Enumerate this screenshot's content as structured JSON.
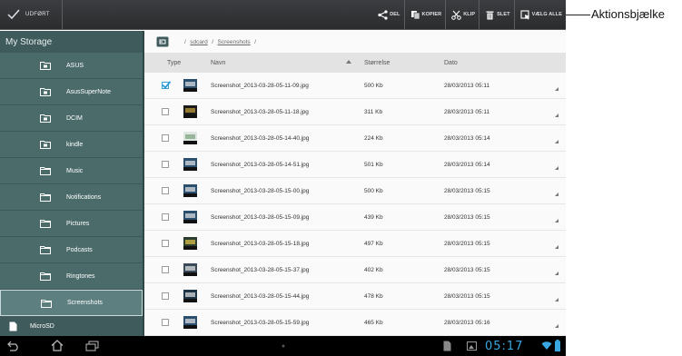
{
  "actionbar": {
    "done_label": "UDFØRT",
    "actions": [
      {
        "label": "DEL",
        "icon": "share-icon"
      },
      {
        "label": "KOPIER",
        "icon": "copy-icon"
      },
      {
        "label": "KLIP",
        "icon": "scissors-icon"
      },
      {
        "label": "SLET",
        "icon": "trash-icon"
      },
      {
        "label": "VÆLG ALLE",
        "icon": "select-all-icon"
      }
    ]
  },
  "callout": {
    "text": "Aktionsbjælke"
  },
  "sidebar": {
    "header": "My Storage",
    "folders": [
      {
        "label": "ASUS",
        "icon": "folder-sync-icon"
      },
      {
        "label": "AsusSuperNote",
        "icon": "folder-sync-icon"
      },
      {
        "label": "DCIM",
        "icon": "folder-sync-icon"
      },
      {
        "label": "kindle",
        "icon": "folder-sync-icon"
      },
      {
        "label": "Music",
        "icon": "folder-icon"
      },
      {
        "label": "Notifications",
        "icon": "folder-icon"
      },
      {
        "label": "Pictures",
        "icon": "folder-icon"
      },
      {
        "label": "Podcasts",
        "icon": "folder-icon"
      },
      {
        "label": "Ringtones",
        "icon": "folder-icon"
      },
      {
        "label": "Screenshots",
        "icon": "folder-icon",
        "selected": true
      }
    ],
    "microsd": "MicroSD"
  },
  "breadcrumb": {
    "sep1": "/",
    "part1": "sdcard",
    "sep2": "/",
    "part2": "Screenshots",
    "sep3": "/"
  },
  "columns": {
    "type": "Type",
    "name": "Navn",
    "size": "Størrelse",
    "date": "Dato"
  },
  "files": [
    {
      "name": "Screenshot_2013-03-28-05-11-09.jpg",
      "size": "500 Kb",
      "date": "28/03/2013 05:11",
      "checked": true
    },
    {
      "name": "Screenshot_2013-03-28-05-11-18.jpg",
      "size": "311 Kb",
      "date": "28/03/2013 05:11",
      "checked": false
    },
    {
      "name": "Screenshot_2013-03-28-05-14-40.jpg",
      "size": "224 Kb",
      "date": "28/03/2013 05:14",
      "checked": false
    },
    {
      "name": "Screenshot_2013-03-28-05-14-51.jpg",
      "size": "501 Kb",
      "date": "28/03/2013 05:14",
      "checked": false
    },
    {
      "name": "Screenshot_2013-03-28-05-15-00.jpg",
      "size": "500 Kb",
      "date": "28/03/2013 05:15",
      "checked": false
    },
    {
      "name": "Screenshot_2013-03-28-05-15-09.jpg",
      "size": "439 Kb",
      "date": "28/03/2013 05:15",
      "checked": false
    },
    {
      "name": "Screenshot_2013-03-28-05-15-18.jpg",
      "size": "497 Kb",
      "date": "28/03/2013 05:15",
      "checked": false
    },
    {
      "name": "Screenshot_2013-03-28-05-15-37.jpg",
      "size": "402 Kb",
      "date": "28/03/2013 05:15",
      "checked": false
    },
    {
      "name": "Screenshot_2013-03-28-05-15-44.jpg",
      "size": "478 Kb",
      "date": "28/03/2013 05:15",
      "checked": false
    },
    {
      "name": "Screenshot_2013-03-28-05-15-59.jpg",
      "size": "465 Kb",
      "date": "28/03/2013 05:16",
      "checked": false
    }
  ],
  "statusbar": {
    "clock": "05:17"
  },
  "colors": {
    "accent": "#3aa8e0",
    "sidebar": "#4b6b6b",
    "actionbar": "#2f3133"
  }
}
